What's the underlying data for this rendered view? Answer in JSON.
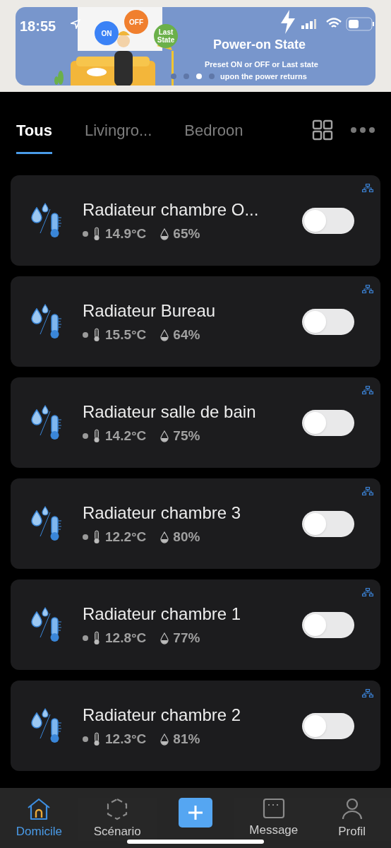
{
  "status_bar": {
    "time": "18:55"
  },
  "banner": {
    "title": "Power-on State",
    "line_1": "Preset ON or OFF or Last state",
    "line_2": "upon the power returns",
    "bubbles": [
      {
        "label": "ON",
        "color": "#3b82f6"
      },
      {
        "label": "OFF",
        "color": "#f07f2e"
      },
      {
        "label": "Last State",
        "color": "#6bb04a"
      }
    ],
    "pages": [
      {
        "selected": false
      },
      {
        "selected": false
      },
      {
        "selected": true
      },
      {
        "selected": false
      }
    ]
  },
  "tabs": [
    {
      "label": "Tous",
      "selected": true
    },
    {
      "label": "Livingro...",
      "selected": false
    },
    {
      "label": "Bedroon",
      "selected": false
    }
  ],
  "devices": [
    {
      "name": "Radiateur chambre O...",
      "temperature": "14.9°C",
      "humidity": "65%",
      "on": false
    },
    {
      "name": "Radiateur Bureau",
      "temperature": "15.5°C",
      "humidity": "64%",
      "on": false
    },
    {
      "name": "Radiateur salle de bain",
      "temperature": "14.2°C",
      "humidity": "75%",
      "on": false
    },
    {
      "name": "Radiateur chambre 3",
      "temperature": "12.2°C",
      "humidity": "80%",
      "on": false
    },
    {
      "name": "Radiateur chambre 1",
      "temperature": "12.8°C",
      "humidity": "77%",
      "on": false
    },
    {
      "name": "Radiateur chambre 2",
      "temperature": "12.3°C",
      "humidity": "81%",
      "on": false
    }
  ],
  "nav": [
    {
      "label": "Domicile",
      "kind": "home",
      "selected": true
    },
    {
      "label": "Scénario",
      "kind": "scene",
      "selected": false
    },
    {
      "kind": "add"
    },
    {
      "label": "Message",
      "kind": "message",
      "selected": false
    },
    {
      "label": "Profil",
      "kind": "profile",
      "selected": false
    }
  ]
}
